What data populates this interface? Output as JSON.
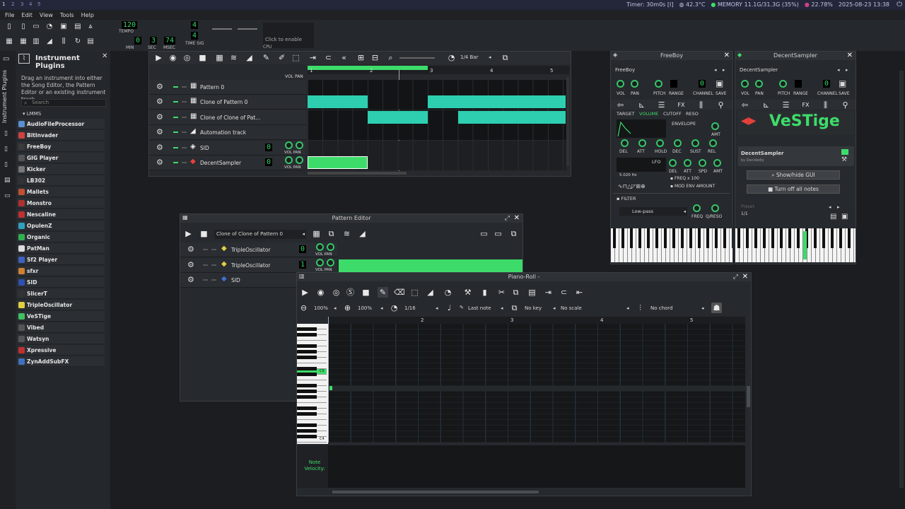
{
  "sysbar": {
    "workspaces": [
      "1",
      "2",
      "3",
      "4",
      "5"
    ],
    "timer": "Timer: 30m0s [I]",
    "temp": "42.3°C",
    "memory": "MEMORY 11.1G/31.3G (35%)",
    "cpu": "22.78%",
    "datetime": "2025-08-23 13:38"
  },
  "menu": [
    "File",
    "Edit",
    "View",
    "Tools",
    "Help"
  ],
  "transport": {
    "tempo": "120",
    "tempo_label": "TEMPO",
    "min": "0",
    "min_label": "MIN",
    "sec": "3",
    "sec_label": "SEC",
    "msec": "74",
    "msec_label": "MSEC",
    "timesig_num": "4",
    "timesig_den": "4",
    "timesig_label": "TIME SIG",
    "cpu_hint": "Click to enable",
    "cpu_label": "CPU"
  },
  "plugins_panel": {
    "title": "Instrument Plugins",
    "tab_label": "Instrument Plugins",
    "description": "Drag an instrument into either the Song Editor, the Pattern Editor or an existing instrument track.",
    "search_placeholder": "Search",
    "root": "LMMS",
    "items": [
      {
        "name": "AudioFileProcessor",
        "color": "#5a8fd0"
      },
      {
        "name": "BitInvader",
        "color": "#d04040"
      },
      {
        "name": "FreeBoy",
        "color": "#3a3a3a"
      },
      {
        "name": "GIG Player",
        "color": "#555"
      },
      {
        "name": "Kicker",
        "color": "#777"
      },
      {
        "name": "LB302",
        "color": "#333"
      },
      {
        "name": "Mallets",
        "color": "#c05030"
      },
      {
        "name": "Monstro",
        "color": "#b03030"
      },
      {
        "name": "Nescaline",
        "color": "#c03030"
      },
      {
        "name": "OpulenZ",
        "color": "#30a0c0"
      },
      {
        "name": "Organic",
        "color": "#30b050"
      },
      {
        "name": "PatMan",
        "color": "#ddd"
      },
      {
        "name": "Sf2 Player",
        "color": "#4060c0"
      },
      {
        "name": "sfxr",
        "color": "#d08030"
      },
      {
        "name": "SID",
        "color": "#3050b0"
      },
      {
        "name": "SlicerT",
        "color": "#333"
      },
      {
        "name": "TripleOscillator",
        "color": "#e0d040"
      },
      {
        "name": "VeSTige",
        "color": "#40c060"
      },
      {
        "name": "Vibed",
        "color": "#555"
      },
      {
        "name": "Watsyn",
        "color": "#555"
      },
      {
        "name": "Xpressive",
        "color": "#c03030"
      },
      {
        "name": "ZynAddSubFX",
        "color": "#4070c0"
      }
    ]
  },
  "song_editor": {
    "quantize": "1/4 Bar",
    "ruler": [
      "1",
      "2",
      "3",
      "4",
      "5"
    ],
    "vol_pan": "VOL PAN",
    "tracks": [
      {
        "name": "Pattern 0",
        "type": "pattern"
      },
      {
        "name": "Clone of Pattern 0",
        "type": "pattern"
      },
      {
        "name": "Clone of Clone of Pat...",
        "type": "pattern"
      },
      {
        "name": "Automation track",
        "type": "automation"
      },
      {
        "name": "SID",
        "type": "instrument",
        "lcd": "0"
      },
      {
        "name": "DecentSampler",
        "type": "instrument",
        "lcd": "0"
      }
    ]
  },
  "pattern_editor": {
    "title": "Pattern Editor",
    "pattern": "Clone of Clone of Pattern 0",
    "vol_pan": "VOL PAN",
    "tracks": [
      {
        "name": "TripleOscillator",
        "lcd": "0"
      },
      {
        "name": "TripleOscillator",
        "lcd": "1"
      },
      {
        "name": "SID",
        "lcd": ""
      }
    ]
  },
  "piano_roll": {
    "title": "Piano-Roll -",
    "zoom_x": "100%",
    "zoom_y": "100%",
    "quantize": "1/16",
    "note_length": "Last note",
    "key": "No key",
    "scale": "No scale",
    "chord": "No chord",
    "ruler": [
      "2",
      "3",
      "4",
      "5"
    ],
    "key_c5": "C5",
    "key_c4": "C4",
    "velocity_label": "Note Velocity:"
  },
  "freeboy": {
    "title": "FreeBoy",
    "name": "FreeBoy",
    "labels": {
      "vol": "VOL",
      "pan": "PAN",
      "pitch": "PITCH",
      "range": "RANGE",
      "channel": "CHANNEL",
      "save": "SAVE"
    },
    "tabs": [
      "TARGET",
      "VOLUME",
      "CUTOFF",
      "RESO"
    ],
    "envelope": "ENVELOPE",
    "amt": "AMT",
    "env_knobs": [
      "DEL",
      "ATT",
      "HOLD",
      "DEC",
      "SUST",
      "REL"
    ],
    "lfo": "LFO",
    "lfo_knobs": [
      "DEL",
      "ATT",
      "SPD",
      "AMT"
    ],
    "freq_hz": "5.020 Hz",
    "freq_x100": "FREQ x 100",
    "mod_env": "MOD ENV AMOUNT",
    "filter": "FILTER",
    "filter_type": "Low-pass",
    "freq": "FREQ",
    "qreso": "Q/RESO",
    "channel_lcd": "0"
  },
  "decentsampler": {
    "title": "DecentSampler",
    "name": "DecentSampler",
    "labels": {
      "vol": "VOL",
      "pan": "PAN",
      "pitch": "PITCH",
      "range": "RANGE",
      "channel": "CHANNEL",
      "save": "SAVE"
    },
    "logo": "VeSTige",
    "plugin_name": "DecentSampler",
    "plugin_by": "by Decidedly",
    "show_gui": "Show/hide GUI",
    "turn_off": "Turn off all notes",
    "preset": "Preset",
    "preset_count": "1/1",
    "channel_lcd": "0"
  },
  "colors": {
    "accent": "#3ddc6a",
    "clip": "#2ecfb0",
    "bg": "#1b1d20"
  }
}
